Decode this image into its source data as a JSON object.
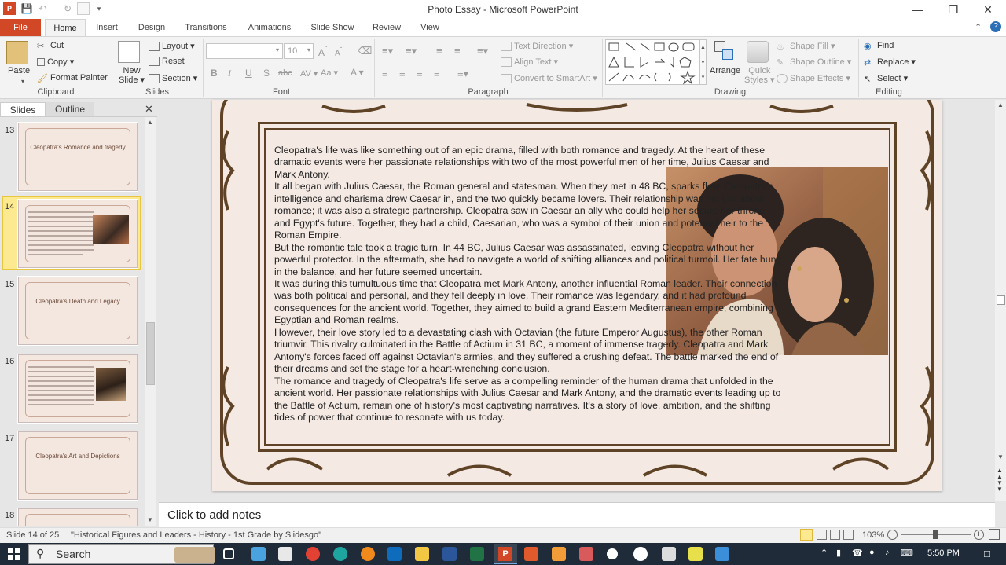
{
  "window": {
    "title": "Photo Essay  -  Microsoft PowerPoint"
  },
  "tabs": [
    "File",
    "Home",
    "Insert",
    "Design",
    "Transitions",
    "Animations",
    "Slide Show",
    "Review",
    "View"
  ],
  "ribbon": {
    "clipboard": {
      "paste": "Paste",
      "cut": "Cut",
      "copy": "Copy",
      "format_painter": "Format Painter",
      "label": "Clipboard"
    },
    "slides": {
      "new_slide_1": "New",
      "new_slide_2": "Slide",
      "layout": "Layout",
      "reset": "Reset",
      "section": "Section",
      "label": "Slides"
    },
    "font": {
      "size": "10",
      "label": "Font"
    },
    "paragraph": {
      "text_direction": "Text Direction",
      "align_text": "Align Text",
      "smartart": "Convert to SmartArt",
      "label": "Paragraph"
    },
    "drawing": {
      "arrange": "Arrange",
      "quick_styles_1": "Quick",
      "quick_styles_2": "Styles",
      "shape_fill": "Shape Fill",
      "shape_outline": "Shape Outline",
      "shape_effects": "Shape Effects",
      "label": "Drawing"
    },
    "editing": {
      "find": "Find",
      "replace": "Replace",
      "select": "Select",
      "label": "Editing"
    }
  },
  "panel": {
    "tab_slides": "Slides",
    "tab_outline": "Outline",
    "thumbs": [
      {
        "num": "13",
        "title": "Cleopatra's Romance and tragedy"
      },
      {
        "num": "14",
        "title": ""
      },
      {
        "num": "15",
        "title": "Cleopatra's Death and Legacy"
      },
      {
        "num": "16",
        "title": ""
      },
      {
        "num": "17",
        "title": "Cleopatra's Art and Depictions"
      },
      {
        "num": "18",
        "title": ""
      }
    ]
  },
  "slide": {
    "paragraphs": [
      "Cleopatra's life was like something out of an epic drama, filled with both romance and tragedy. At the heart of these dramatic events were her passionate relationships with two of the most powerful men of her time, Julius Caesar and Mark Antony.",
      "It all began with Julius Caesar, the Roman general and statesman. When they met in 48 BC, sparks flew. Cleopatra's intelligence and charisma drew Caesar in, and the two quickly became lovers. Their relationship was not just about romance; it was also a strategic partnership. Cleopatra saw in Caesar an ally who could help her secure her throne and Egypt's future. Together, they had a child, Caesarian, who was a symbol of their union and potential heir to the Roman Empire.",
      "But the romantic tale took a tragic turn. In 44 BC, Julius Caesar was assassinated, leaving Cleopatra without her powerful protector. In the aftermath, she had to navigate a world of shifting alliances and political turmoil. Her fate hung in the balance, and her future seemed uncertain.",
      "It was during this tumultuous time that Cleopatra met Mark Antony, another influential Roman leader. Their connection was both political and personal, and they fell deeply in love. Their romance was legendary, and it had profound consequences for the ancient world. Together, they aimed to build a grand Eastern Mediterranean empire, combining Egyptian and Roman realms.",
      "However, their love story led to a devastating clash with Octavian (the future Emperor Augustus), the other Roman triumvir. This rivalry culminated in the Battle of Actium in 31 BC, a moment of immense tragedy. Cleopatra and Mark Antony's forces faced off against Octavian's armies, and they suffered a crushing defeat. The battle marked the end of their dreams and set the stage for a heart-wrenching conclusion.",
      "The romance and tragedy of Cleopatra's life serve as a compelling reminder of the human drama that unfolded in the ancient world. Her passionate relationships with Julius Caesar and Mark Antony, and the dramatic events leading up to the Battle of Actium, remain one of history's most captivating narratives. It's a story of love, ambition, and the shifting tides of power that continue to resonate with us today."
    ]
  },
  "notes": {
    "placeholder": "Click to add notes"
  },
  "status": {
    "slide": "Slide 14 of 25",
    "theme": "\"Historical Figures and Leaders - History - 1st Grade by Slidesgo\"",
    "zoom": "103%"
  },
  "taskbar": {
    "search": "Search",
    "time": "5:50 PM"
  },
  "colors": {
    "file_tab": "#d24726",
    "frame": "#5e4326",
    "slide_bg": "#f5e9e3",
    "taskbar": "#1f2b38"
  }
}
